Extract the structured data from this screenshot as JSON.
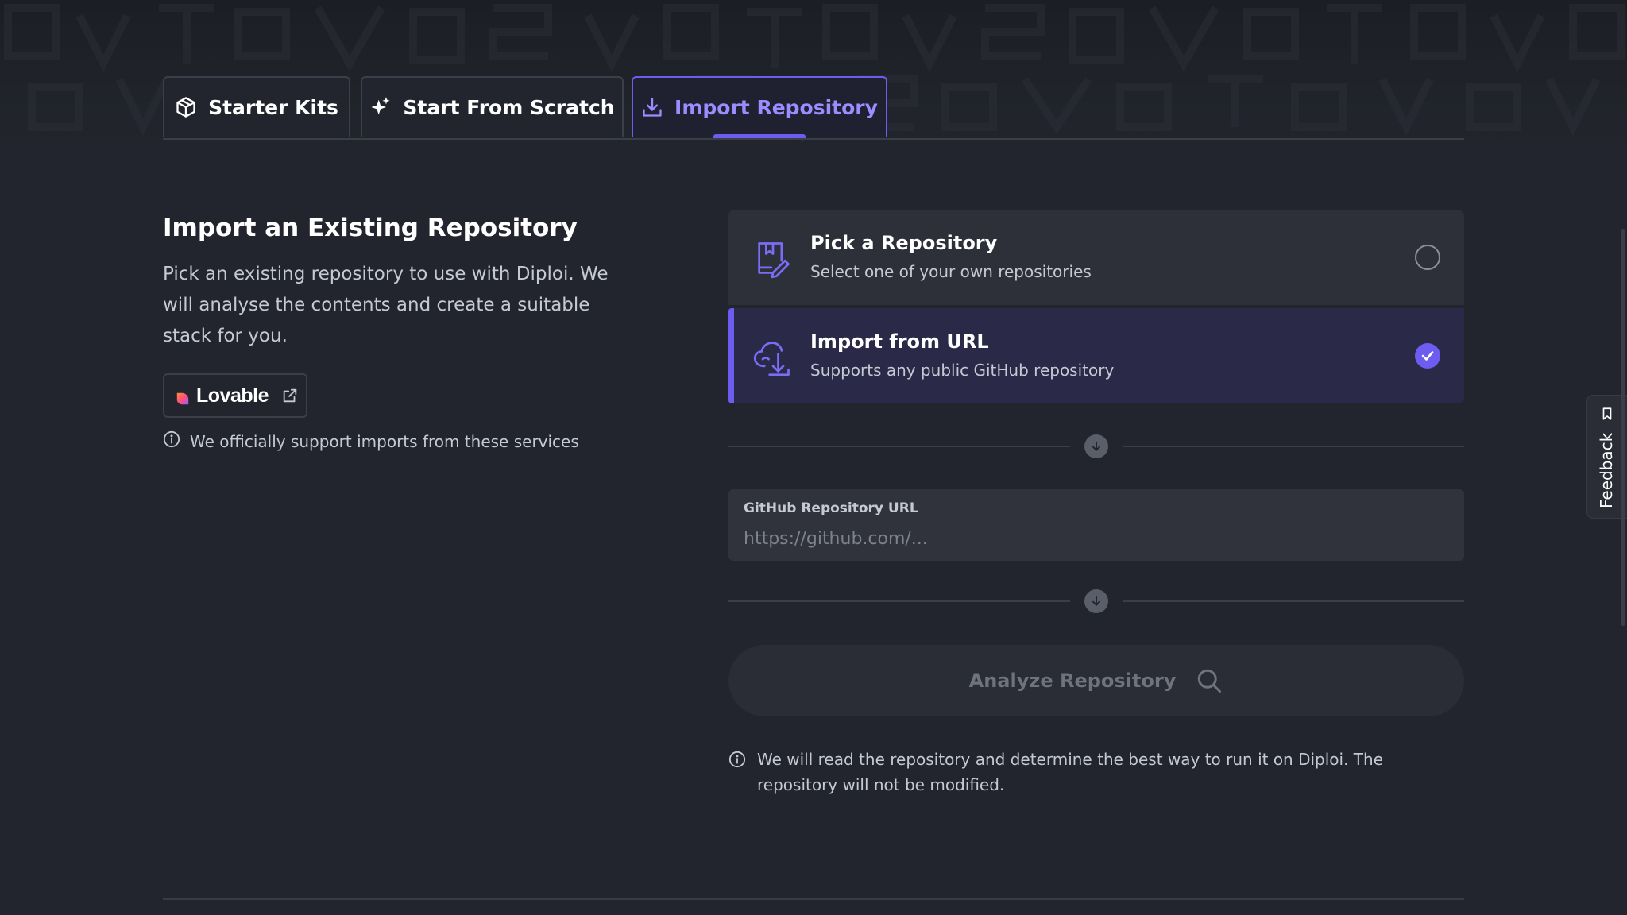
{
  "tabs": [
    {
      "label": "Starter Kits",
      "icon": "cube-icon",
      "active": false
    },
    {
      "label": "Start From Scratch",
      "icon": "sparkle-icon",
      "active": false
    },
    {
      "label": "Import Repository",
      "icon": "download-icon",
      "active": true
    }
  ],
  "intro": {
    "title": "Import an Existing Repository",
    "description": "Pick an existing repository to use with Diploi. We will analyse the contents and create a suitable stack for you.",
    "service_badge": "Lovable",
    "support_note": "We officially support imports from these services"
  },
  "options": [
    {
      "title": "Pick a Repository",
      "subtitle": "Select one of your own repositories",
      "selected": false
    },
    {
      "title": "Import from URL",
      "subtitle": "Supports any public GitHub repository",
      "selected": true
    }
  ],
  "url_field": {
    "label": "GitHub Repository URL",
    "placeholder": "https://github.com/...",
    "value": ""
  },
  "analyze_button": "Analyze Repository",
  "read_note": "We will read the repository and determine the best way to run it on Diploi. The repository will not be modified.",
  "feedback_label": "Feedback",
  "colors": {
    "background": "#22252d",
    "accent": "#6d5cf0",
    "selected_option_bg": "#2a2948",
    "option_bg": "#2d3039"
  }
}
